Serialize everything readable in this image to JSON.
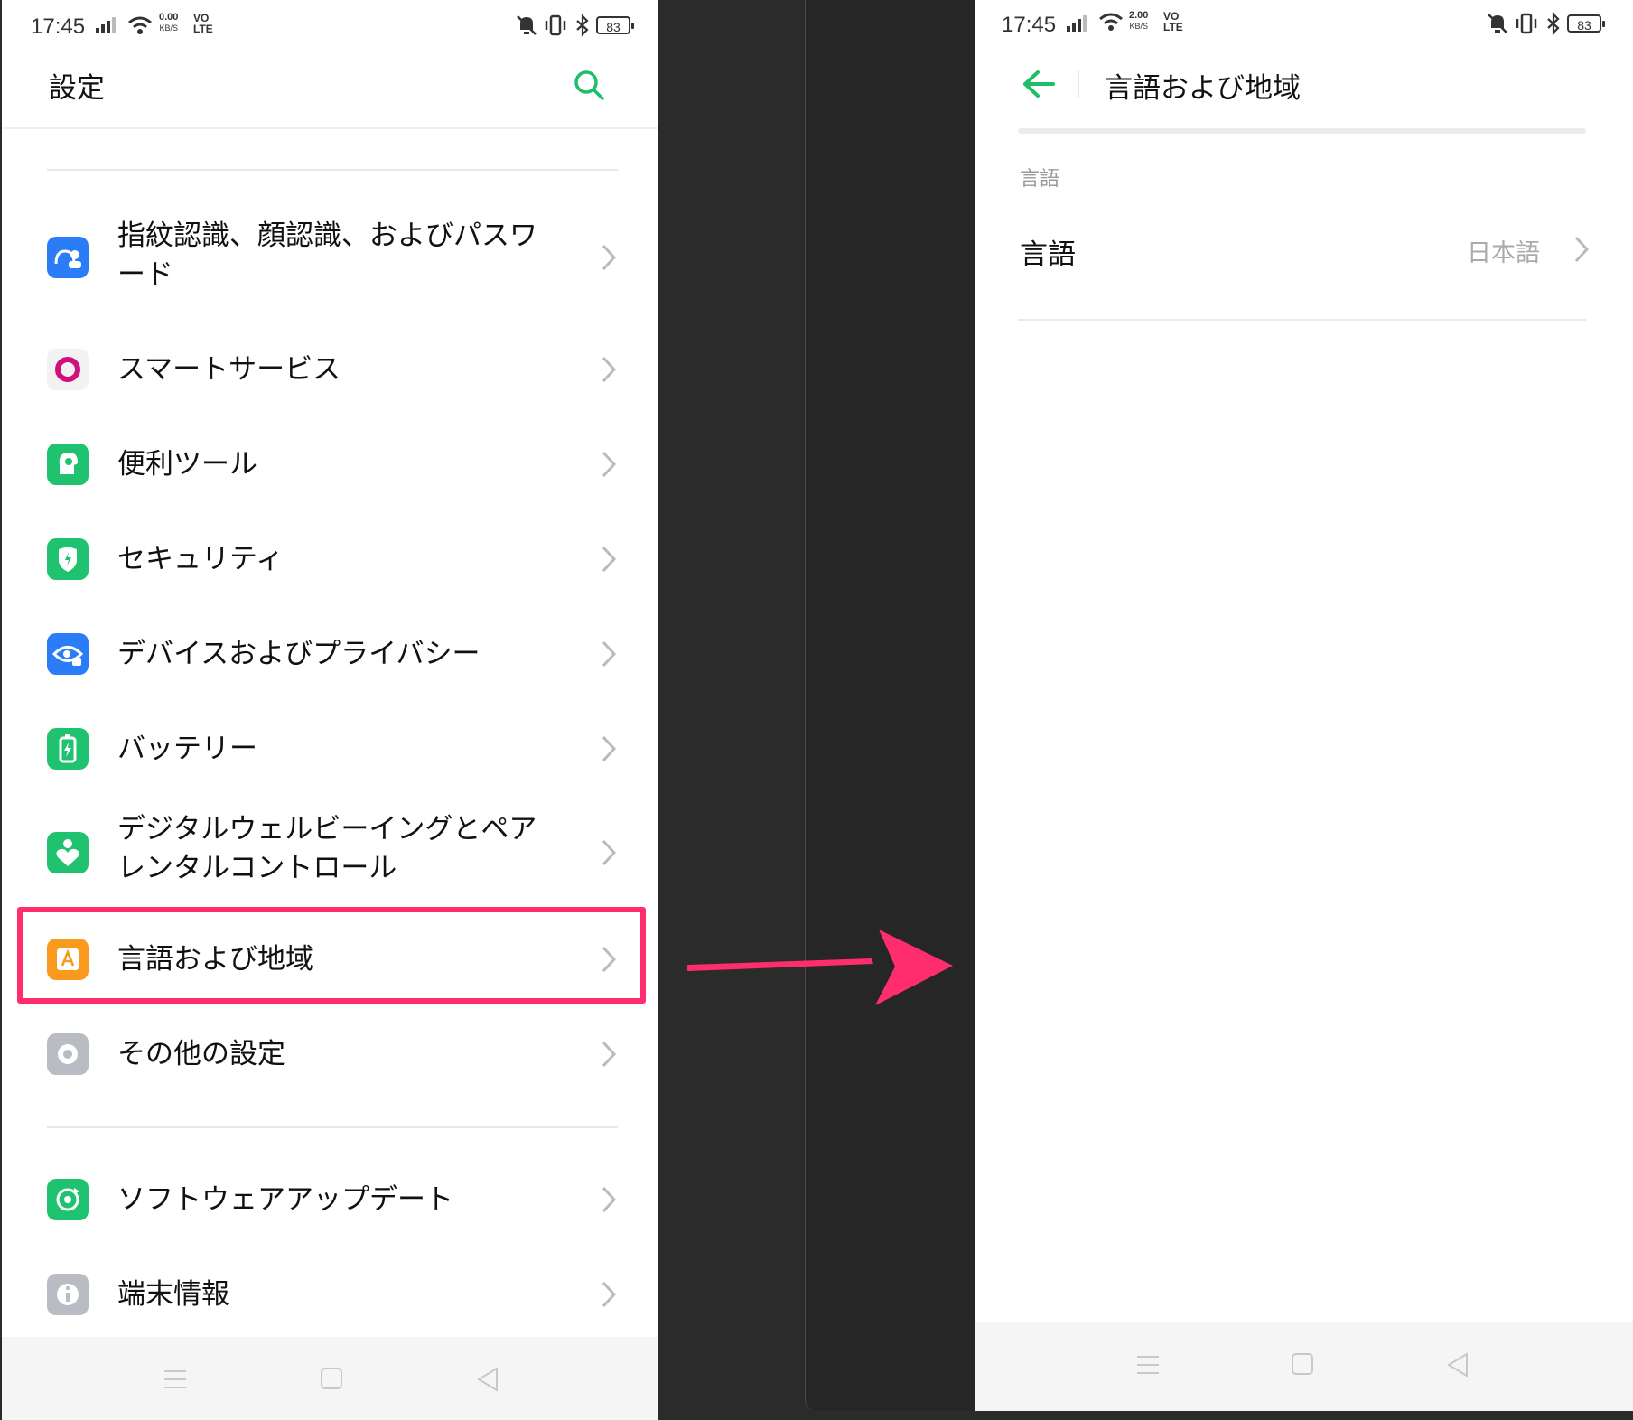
{
  "left": {
    "status": {
      "time": "17:45",
      "speed": "0.00",
      "speed_unit": "KB/S",
      "vo": "VO",
      "lte": "LTE",
      "battery": "83"
    },
    "title": "設定",
    "items": [
      {
        "label_line1": "指紋認識、顔認識、およびパスワ",
        "label_line2": "ード",
        "icon": "fingerprint-face-icon",
        "color": "#2a7cf7"
      },
      {
        "label": "スマートサービス",
        "icon": "smart-service-icon",
        "color": "#e8197a"
      },
      {
        "label": "便利ツール",
        "icon": "tools-icon",
        "color": "#1fc36f"
      },
      {
        "label": "セキュリティ",
        "icon": "shield-icon",
        "color": "#1fc36f"
      },
      {
        "label": "デバイスおよびプライバシー",
        "icon": "privacy-eye-icon",
        "color": "#2a7cf7"
      },
      {
        "label": "バッテリー",
        "icon": "battery-icon",
        "color": "#1fc36f"
      },
      {
        "label_line1": "デジタルウェルビーイングとペア",
        "label_line2": "レンタルコントロール",
        "icon": "wellbeing-icon",
        "color": "#1fc36f"
      },
      {
        "label": "言語および地域",
        "icon": "language-icon",
        "color": "#f99a1c"
      },
      {
        "label": "その他の設定",
        "icon": "more-settings-icon",
        "color": "#b9bcc2"
      },
      {
        "label": "ソフトウェアアップデート",
        "icon": "software-update-icon",
        "color": "#1fc36f"
      },
      {
        "label": "端末情報",
        "icon": "info-icon",
        "color": "#b9bcc2"
      }
    ]
  },
  "right": {
    "status": {
      "time": "17:45",
      "speed": "2.00",
      "speed_unit": "KB/S",
      "vo": "VO",
      "lte": "LTE",
      "battery": "83"
    },
    "title": "言語および地域",
    "section": "言語",
    "item_label": "言語",
    "item_value": "日本語"
  },
  "colors": {
    "accent": "#1fbf6a",
    "highlight": "#ff2d6e",
    "arrow": "#ff2d6e"
  }
}
